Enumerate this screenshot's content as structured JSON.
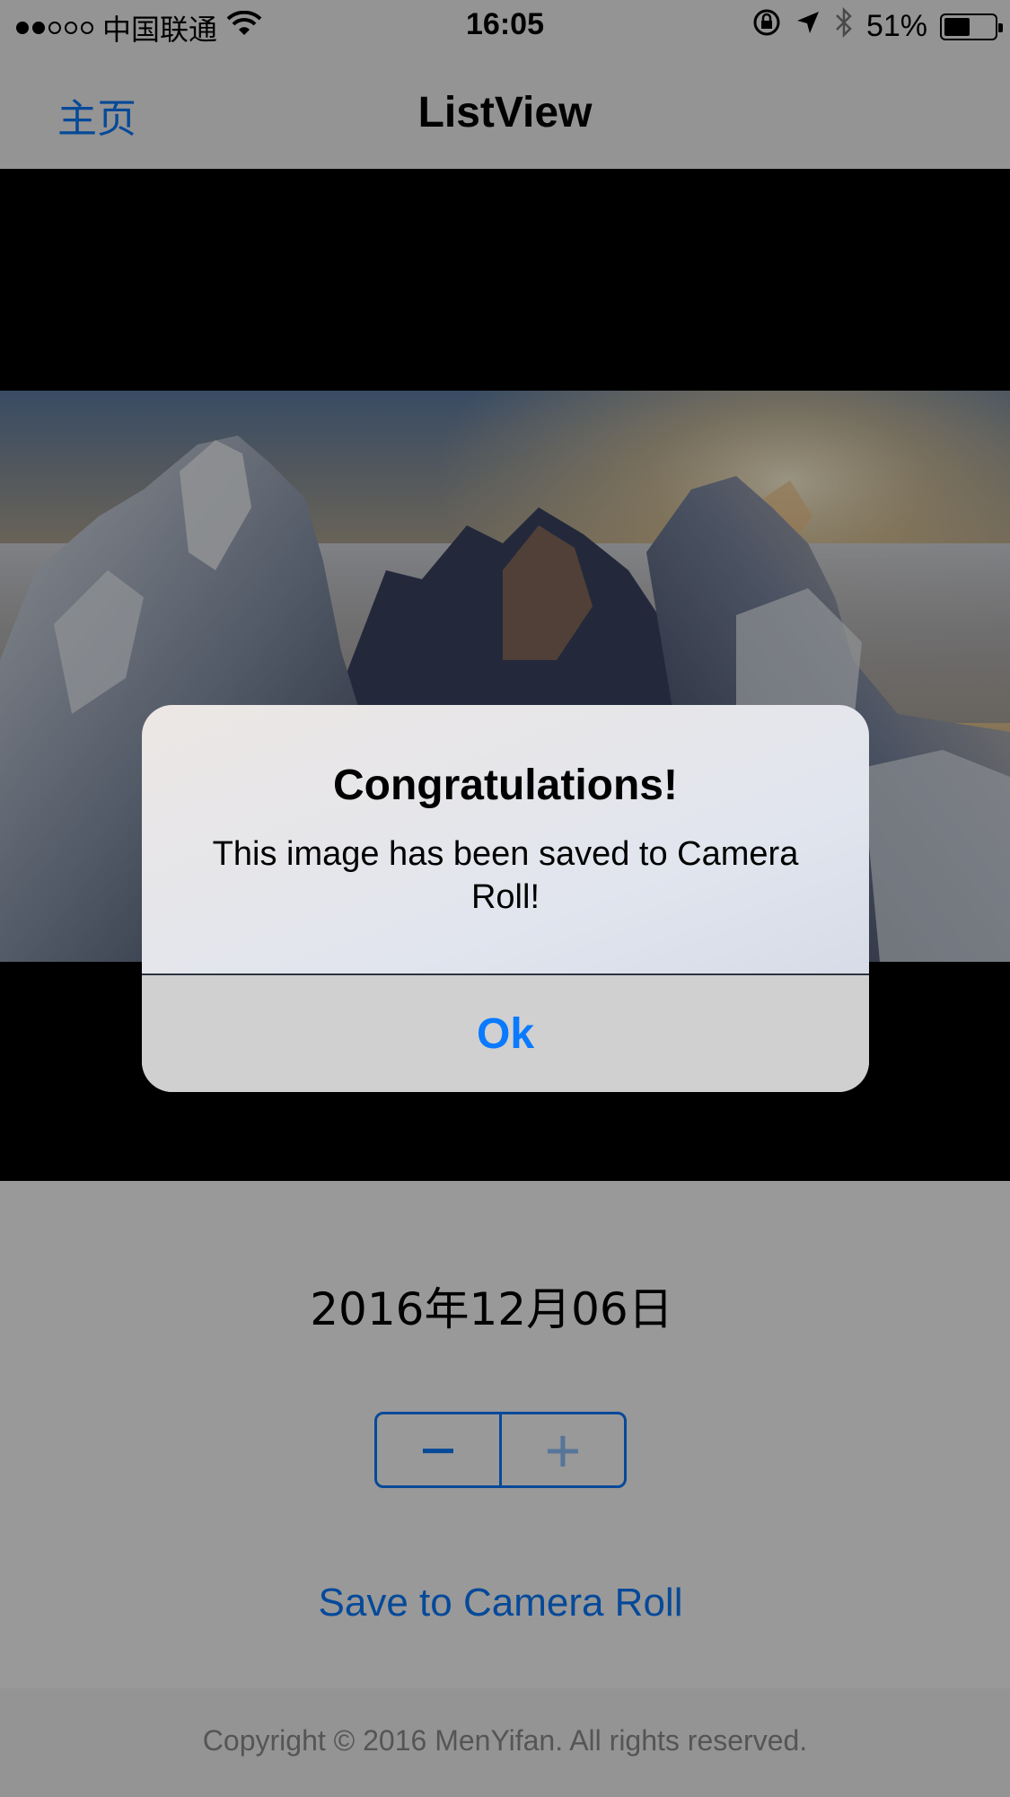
{
  "status_bar": {
    "carrier": "中国联通",
    "time": "16:05",
    "battery": "51%",
    "battery_level": 0.51,
    "signal_bars": 2,
    "signal_total": 5,
    "icons": [
      "wifi-icon",
      "rotation-lock-icon",
      "location-icon",
      "bluetooth-icon",
      "battery-icon"
    ]
  },
  "navbar": {
    "back_label": "主页",
    "title": "ListView"
  },
  "content": {
    "date": "2016年12月06日",
    "stepper": {
      "minus": "−",
      "plus": "+"
    },
    "save_label": "Save to Camera Roll",
    "copyright": "Copyright © 2016 MenYifan. All rights reserved."
  },
  "alert": {
    "title": "Congratulations!",
    "message": "This image has been saved to Camera Roll!",
    "button": "Ok"
  },
  "colors": {
    "accent": "#0a7aff",
    "bar_background": "#f7f7f7",
    "image_background": "#000000"
  }
}
